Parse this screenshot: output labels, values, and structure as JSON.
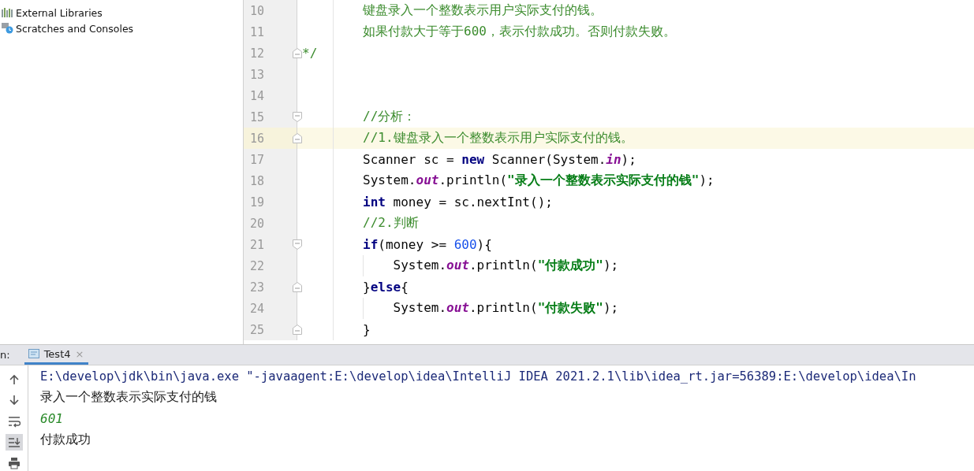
{
  "project_tree": {
    "items": [
      {
        "label": "External Libraries",
        "kind": "libraries"
      },
      {
        "label": "Scratches and Consoles",
        "kind": "scratches"
      }
    ]
  },
  "editor": {
    "lines": [
      {
        "number": "10",
        "highlighted": false,
        "fold_start": false,
        "fold_end": false,
        "tokens": [
          {
            "kind": "comment",
            "text": "        键盘录入一个整数表示用户实际支付的钱。"
          }
        ]
      },
      {
        "number": "11",
        "highlighted": false,
        "fold_start": false,
        "fold_end": false,
        "tokens": [
          {
            "kind": "comment",
            "text": "        如果付款大于等于600，表示付款成功。否则付款失败。"
          }
        ]
      },
      {
        "number": "12",
        "highlighted": false,
        "fold_start": false,
        "fold_end": true,
        "tokens": [
          {
            "kind": "comment",
            "text": "*/"
          }
        ]
      },
      {
        "number": "13",
        "highlighted": false,
        "fold_start": false,
        "fold_end": false
      },
      {
        "number": "14",
        "highlighted": false,
        "fold_start": false,
        "fold_end": false
      },
      {
        "number": "15",
        "highlighted": false,
        "fold_start": true,
        "fold_end": false,
        "tokens": [
          {
            "kind": "comment",
            "text": "        //分析："
          }
        ]
      },
      {
        "number": "16",
        "highlighted": true,
        "fold_start": false,
        "fold_end": true,
        "tokens": [
          {
            "kind": "comment",
            "text": "        //1.键盘录入一个整数表示用户实际支付的钱。"
          }
        ]
      },
      {
        "number": "17",
        "highlighted": false,
        "fold_start": false,
        "fold_end": false,
        "tokens": [
          {
            "kind": "plain",
            "text": "        Scanner sc = "
          },
          {
            "kind": "keyword",
            "text": "new"
          },
          {
            "kind": "plain",
            "text": " Scanner(System."
          },
          {
            "kind": "static",
            "text": "in"
          },
          {
            "kind": "plain",
            "text": ");"
          }
        ]
      },
      {
        "number": "18",
        "highlighted": false,
        "fold_start": false,
        "fold_end": false,
        "tokens": [
          {
            "kind": "plain",
            "text": "        System."
          },
          {
            "kind": "static",
            "text": "out"
          },
          {
            "kind": "plain",
            "text": ".println("
          },
          {
            "kind": "string",
            "text": "\"录入一个整数表示实际支付的钱\""
          },
          {
            "kind": "plain",
            "text": ");"
          }
        ]
      },
      {
        "number": "19",
        "highlighted": false,
        "fold_start": false,
        "fold_end": false,
        "tokens": [
          {
            "kind": "keyword",
            "text": "        int"
          },
          {
            "kind": "plain",
            "text": " money = sc.nextInt();"
          }
        ]
      },
      {
        "number": "20",
        "highlighted": false,
        "fold_start": false,
        "fold_end": false,
        "tokens": [
          {
            "kind": "comment",
            "text": "        //2.判断"
          }
        ]
      },
      {
        "number": "21",
        "highlighted": false,
        "fold_start": true,
        "fold_end": false,
        "tokens": [
          {
            "kind": "keyword",
            "text": "        if"
          },
          {
            "kind": "plain",
            "text": "(money >= "
          },
          {
            "kind": "number",
            "text": "600"
          },
          {
            "kind": "plain",
            "text": "){"
          }
        ]
      },
      {
        "number": "22",
        "highlighted": false,
        "fold_start": false,
        "fold_end": false,
        "tokens": [
          {
            "kind": "plain",
            "text": "            System."
          },
          {
            "kind": "static",
            "text": "out"
          },
          {
            "kind": "plain",
            "text": ".println("
          },
          {
            "kind": "string",
            "text": "\"付款成功\""
          },
          {
            "kind": "plain",
            "text": ");"
          }
        ]
      },
      {
        "number": "23",
        "highlighted": false,
        "fold_start": false,
        "fold_end": true,
        "tokens": [
          {
            "kind": "plain",
            "text": "        }"
          },
          {
            "kind": "keyword",
            "text": "else"
          },
          {
            "kind": "plain",
            "text": "{"
          }
        ]
      },
      {
        "number": "24",
        "highlighted": false,
        "fold_start": false,
        "fold_end": false,
        "tokens": [
          {
            "kind": "plain",
            "text": "            System."
          },
          {
            "kind": "static",
            "text": "out"
          },
          {
            "kind": "plain",
            "text": ".println("
          },
          {
            "kind": "string",
            "text": "\"付款失败\""
          },
          {
            "kind": "plain",
            "text": ");"
          }
        ]
      },
      {
        "number": "25",
        "highlighted": false,
        "fold_start": false,
        "fold_end": true,
        "tokens": [
          {
            "kind": "plain",
            "text": "        }"
          }
        ]
      }
    ]
  },
  "run_panel": {
    "label": "n:",
    "tabs": [
      {
        "label": "Test4",
        "selected": true,
        "close": "×"
      }
    ],
    "tools": [
      {
        "kind": "up",
        "selected": false
      },
      {
        "kind": "down",
        "selected": false
      },
      {
        "kind": "wrap",
        "selected": false
      },
      {
        "kind": "scroll",
        "selected": true
      },
      {
        "kind": "print",
        "selected": false
      }
    ],
    "console": [
      {
        "kind": "command",
        "text": "E:\\develop\\jdk\\bin\\java.exe \"-javaagent:E:\\develop\\idea\\IntelliJ IDEA 2021.2.1\\lib\\idea_rt.jar=56389:E:\\develop\\idea\\In"
      },
      {
        "kind": "output",
        "text": "录入一个整数表示实际支付的钱"
      },
      {
        "kind": "input",
        "text": "601"
      },
      {
        "kind": "output",
        "text": "付款成功"
      }
    ]
  }
}
